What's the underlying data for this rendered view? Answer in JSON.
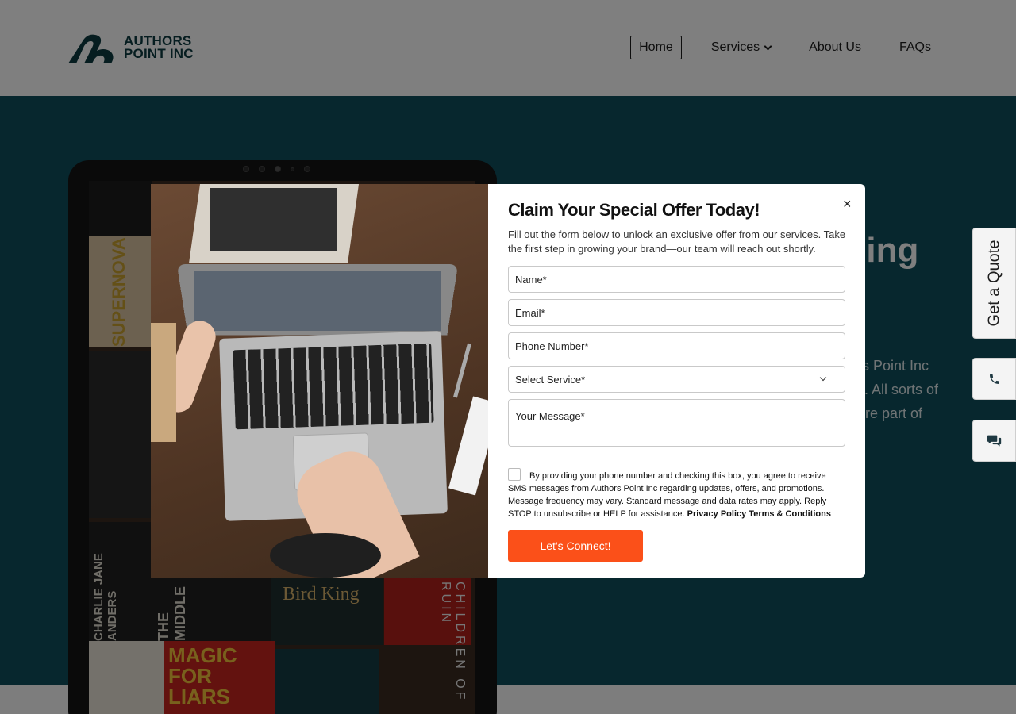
{
  "header": {
    "logo": {
      "line1": "AUTHORS",
      "line2": "POINT INC",
      "icon": "logo-mark-icon"
    },
    "nav": [
      {
        "label": "Home",
        "active": true
      },
      {
        "label": "Services",
        "has_dropdown": true
      },
      {
        "label": "About Us"
      },
      {
        "label": "FAQs"
      }
    ]
  },
  "hero": {
    "heading_fragment": "shing\na",
    "text_fragment": "rs Point Inc\ns. All sorts of\nare part of",
    "background_color": "#0f4e5d",
    "book_titles": [
      "SUPERNOVA",
      "Bird King",
      "CHILDREN OF RUIN",
      "MAGIC FOR LIARS",
      "CHARLIE JANE ANDERS",
      "THE MIDDLE"
    ]
  },
  "side_widgets": {
    "quote_label": "Get a Quote",
    "phone_icon": "phone-icon",
    "chat_icon": "chat-icon"
  },
  "modal": {
    "title": "Claim Your Special Offer Today!",
    "subtitle": "Fill out the form below to unlock an exclusive offer from our services. Take the first step in growing your brand—our team will reach out shortly.",
    "fields": {
      "name_placeholder": "Name*",
      "email_placeholder": "Email*",
      "phone_placeholder": "Phone Number*",
      "service_selected": "Select Service*",
      "message_placeholder": "Your Message*"
    },
    "consent_text": "By providing your phone number and checking this box, you agree to receive SMS messages from Authors Point Inc regarding updates, offers, and promotions. Message frequency may vary. Standard message and data rates may apply. Reply STOP to unsubscribe or HELP for assistance. ",
    "privacy_link": "Privacy Policy",
    "terms_link": "Terms & Conditions",
    "submit_label": "Let's Connect!",
    "close_symbol": "×",
    "accent_color": "#fb5019"
  }
}
